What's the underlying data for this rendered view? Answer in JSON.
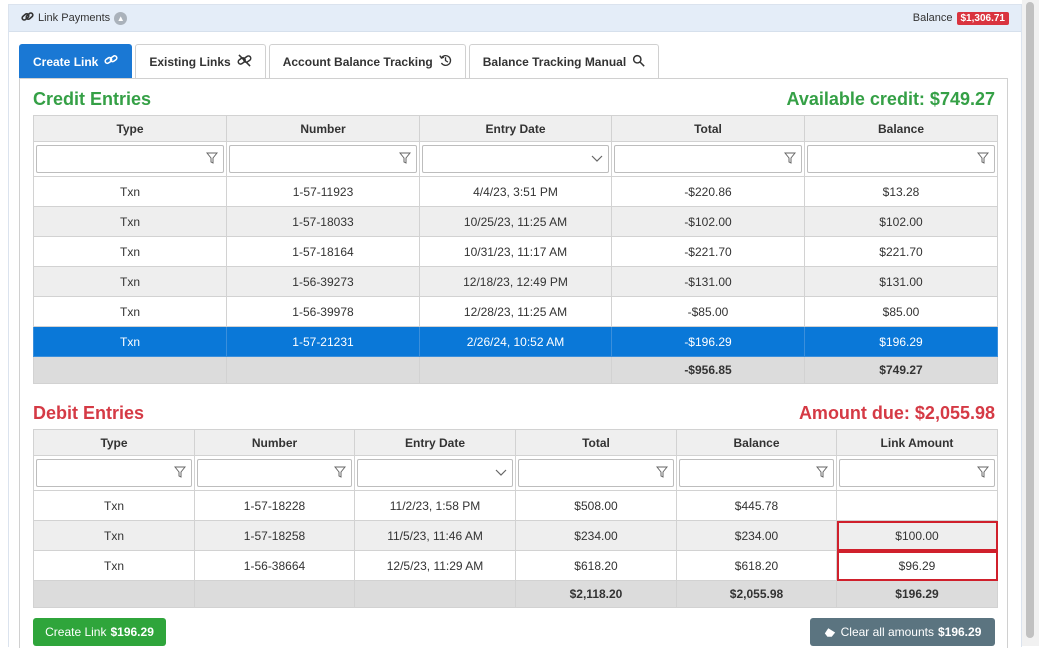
{
  "titlebar": {
    "title": "Link Payments",
    "balance_label": "Balance",
    "balance_value": "$1,306.71",
    "balance_color": "#d9343f"
  },
  "tabs": [
    {
      "label": "Create Link",
      "icon": "link-icon",
      "active": true
    },
    {
      "label": "Existing Links",
      "icon": "unlink-icon",
      "active": false
    },
    {
      "label": "Account Balance Tracking",
      "icon": "history-icon",
      "active": false
    },
    {
      "label": "Balance Tracking Manual",
      "icon": "search-icon",
      "active": false
    }
  ],
  "credit": {
    "title": "Credit Entries",
    "available": "Available credit: $749.27",
    "columns": [
      "Type",
      "Number",
      "Entry Date",
      "Total",
      "Balance"
    ],
    "rows": [
      [
        "Txn",
        "1-57-11923",
        "4/4/23, 3:51 PM",
        "-$220.86",
        "$13.28"
      ],
      [
        "Txn",
        "1-57-18033",
        "10/25/23, 11:25 AM",
        "-$102.00",
        "$102.00"
      ],
      [
        "Txn",
        "1-57-18164",
        "10/31/23, 11:17 AM",
        "-$221.70",
        "$221.70"
      ],
      [
        "Txn",
        "1-56-39273",
        "12/18/23, 12:49 PM",
        "-$131.00",
        "$131.00"
      ],
      [
        "Txn",
        "1-56-39978",
        "12/28/23, 11:25 AM",
        "-$85.00",
        "$85.00"
      ],
      [
        "Txn",
        "1-57-21231",
        "2/26/24, 10:52 AM",
        "-$196.29",
        "$196.29"
      ]
    ],
    "selected_row": 5,
    "totals": [
      "",
      "",
      "",
      "-$956.85",
      "$749.27"
    ]
  },
  "debit": {
    "title": "Debit Entries",
    "amount_due": "Amount due: $2,055.98",
    "columns": [
      "Type",
      "Number",
      "Entry Date",
      "Total",
      "Balance",
      "Link Amount"
    ],
    "rows": [
      [
        "Txn",
        "1-57-18228",
        "11/2/23, 1:58 PM",
        "$508.00",
        "$445.78",
        ""
      ],
      [
        "Txn",
        "1-57-18258",
        "11/5/23, 11:46 AM",
        "$234.00",
        "$234.00",
        "$100.00"
      ],
      [
        "Txn",
        "1-56-38664",
        "12/5/23, 11:29 AM",
        "$618.20",
        "$618.20",
        "$96.29"
      ]
    ],
    "totals": [
      "",
      "",
      "",
      "$2,118.20",
      "$2,055.98",
      "$196.29"
    ]
  },
  "buttons": {
    "create_link_label": "Create Link",
    "create_link_amount": "$196.29",
    "clear_label": "Clear all amounts",
    "clear_amount": "$196.29"
  },
  "colors": {
    "accent": "#1a78d4",
    "selected_row": "#0a78d8",
    "green": "#35a046",
    "red": "#d53a45",
    "create_button": "#2fa53b",
    "clear_button": "#5b7480"
  }
}
